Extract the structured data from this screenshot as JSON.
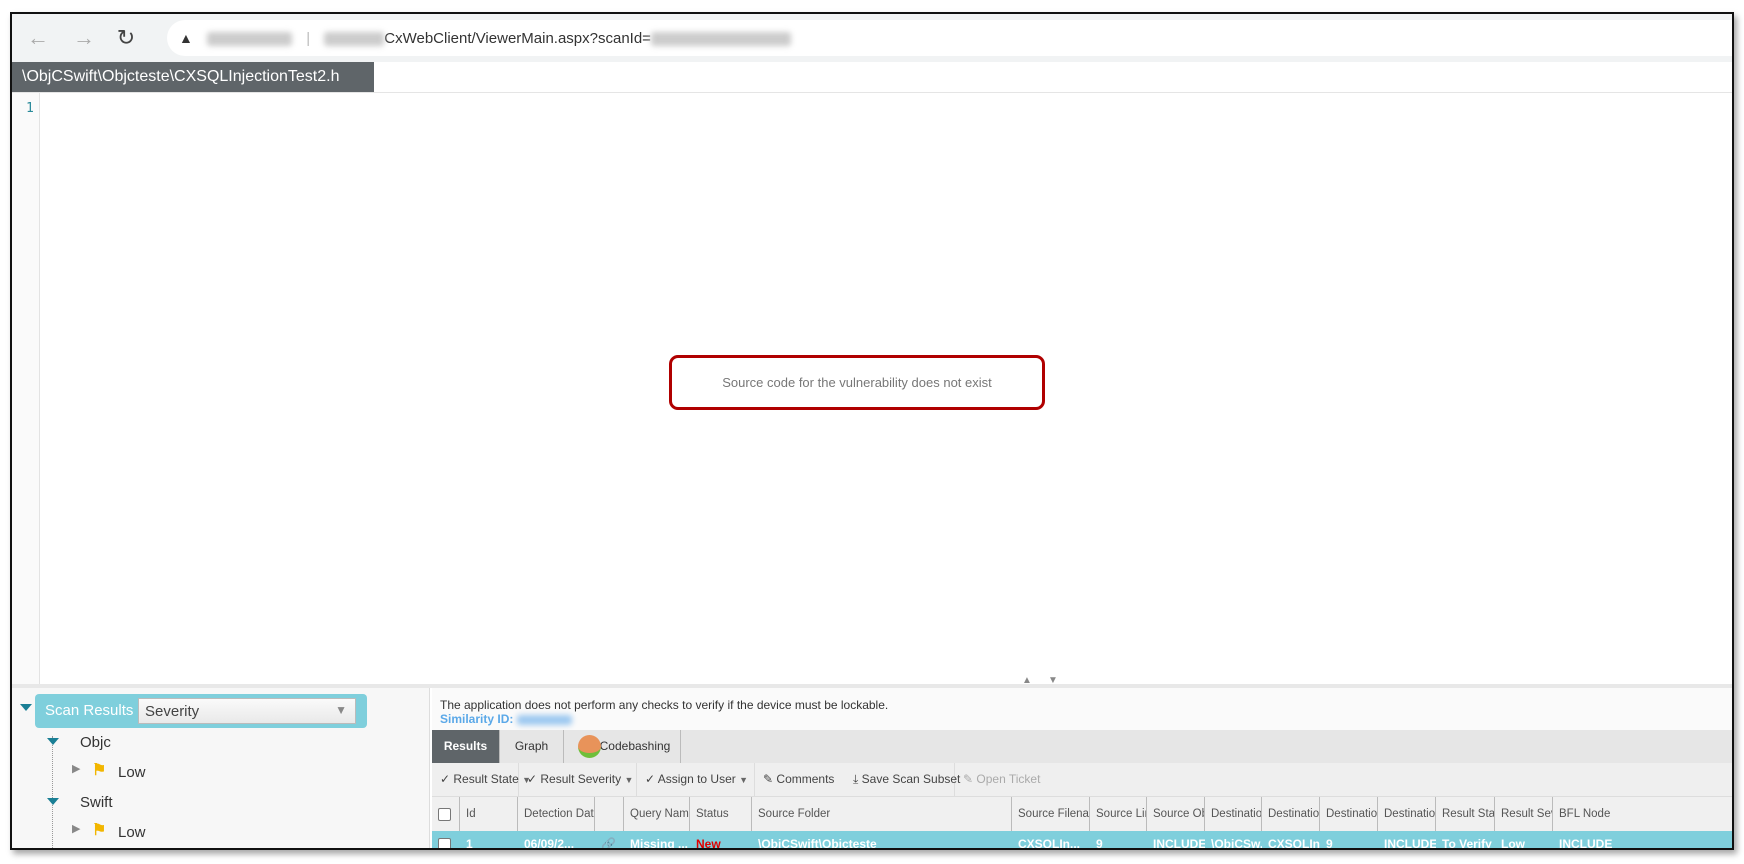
{
  "browser": {
    "url_visible": "CxWebClient/ViewerMain.aspx?scanId=",
    "icons": [
      "back-arrow-icon",
      "forward-arrow-icon",
      "reload-icon",
      "warning-icon"
    ]
  },
  "file_tab": "\\ObjCSwift\\Objcteste\\CXSQLInjectionTest2.h",
  "editor": {
    "line_number": "1",
    "message": "Source code for the vulnerability does not exist"
  },
  "tree": {
    "header": "Scan Results",
    "group_by": "Severity",
    "nodes": [
      {
        "label": "Objc",
        "children": [
          {
            "label": "Low",
            "icon": "flag-icon"
          }
        ]
      },
      {
        "label": "Swift",
        "children": [
          {
            "label": "Low",
            "icon": "flag-icon"
          }
        ]
      }
    ]
  },
  "details": {
    "description": "The application does not perform any checks to verify if the device must be lockable.",
    "similarity_label": "Similarity ID:"
  },
  "tabs": [
    "Results",
    "Graph",
    "Codebashing"
  ],
  "toolbar": [
    "Result State",
    "Result Severity",
    "Assign to User",
    "Comments",
    "Save Scan Subset",
    "Open Ticket"
  ],
  "table": {
    "columns": [
      "Id",
      "Detection Date",
      "",
      "Query Name",
      "Status",
      "Source Folder",
      "Source Filename",
      "Source Line",
      "Source Object",
      "Destination Folder",
      "Destination File",
      "Destination Line",
      "Destination Object",
      "Result State",
      "Result Severity",
      "BFL Node"
    ],
    "rows": [
      [
        "1",
        "06/09/2...",
        "",
        "Missing ...",
        "New",
        "\\ObjCSwift\\Objcteste",
        "CXSQLIn...",
        "9",
        "INCLUDE...",
        "\\ObjCSw...",
        "CXSQLIn...",
        "9",
        "INCLUDE...",
        "To Verify",
        "Low",
        "INCLUDE"
      ]
    ]
  },
  "colors": {
    "accent": "#7fcfdc",
    "status_new": "#e00000",
    "highlight_border": "#b00000",
    "flag": "#f2b600"
  }
}
